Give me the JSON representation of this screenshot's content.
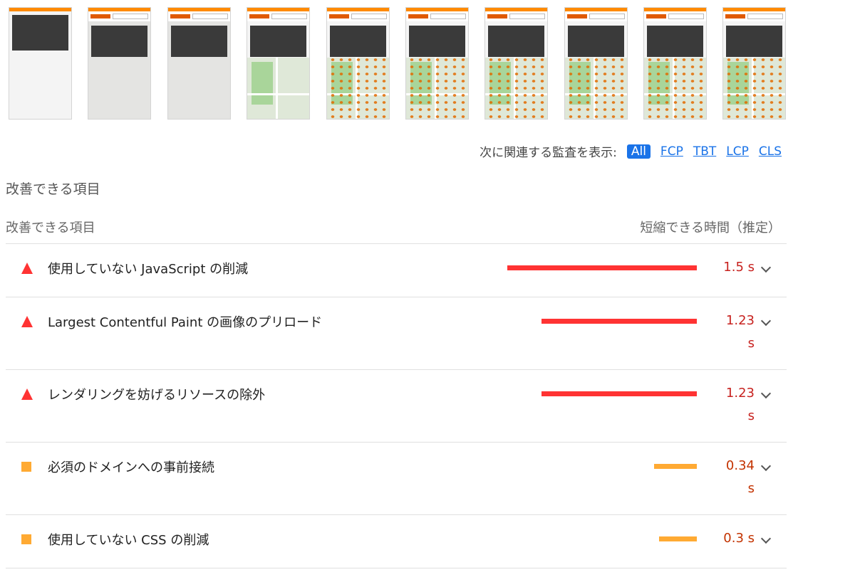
{
  "filmstrip": {
    "frames": [
      {
        "id": 0,
        "state": "header-only"
      },
      {
        "id": 1,
        "state": "gray"
      },
      {
        "id": 2,
        "state": "gray"
      },
      {
        "id": 3,
        "state": "map"
      },
      {
        "id": 4,
        "state": "map-markers"
      },
      {
        "id": 5,
        "state": "map-markers"
      },
      {
        "id": 6,
        "state": "map-markers"
      },
      {
        "id": 7,
        "state": "map-markers"
      },
      {
        "id": 8,
        "state": "map-markers"
      },
      {
        "id": 9,
        "state": "map-markers"
      }
    ]
  },
  "filter": {
    "label": "次に関連する監査を表示:",
    "chips": [
      "All",
      "FCP",
      "TBT",
      "LCP",
      "CLS"
    ],
    "active": "All"
  },
  "section": {
    "title": "改善できる項目",
    "header_left": "改善できる項目",
    "header_right": "短縮できる時間（推定）"
  },
  "colors": {
    "fail": "#ff3333",
    "average": "#ffaa33",
    "fail_text": "#c7221f",
    "average_text": "#c33300",
    "accent": "#1a73e8"
  },
  "audits": [
    {
      "title": "使用していない JavaScript の削減",
      "value_line1": "1.5 s",
      "value_line2": "",
      "severity": "fail",
      "seconds": 1.5
    },
    {
      "title": "Largest Contentful Paint の画像のプリロード",
      "value_line1": "1.23",
      "value_line2": "s",
      "severity": "fail",
      "seconds": 1.23
    },
    {
      "title": "レンダリングを妨げるリソースの除外",
      "value_line1": "1.23",
      "value_line2": "s",
      "severity": "fail",
      "seconds": 1.23
    },
    {
      "title": "必須のドメインへの事前接続",
      "value_line1": "0.34",
      "value_line2": "s",
      "severity": "average",
      "seconds": 0.34
    },
    {
      "title": "使用していない CSS の削減",
      "value_line1": "0.3 s",
      "value_line2": "",
      "severity": "average",
      "seconds": 0.3
    }
  ]
}
